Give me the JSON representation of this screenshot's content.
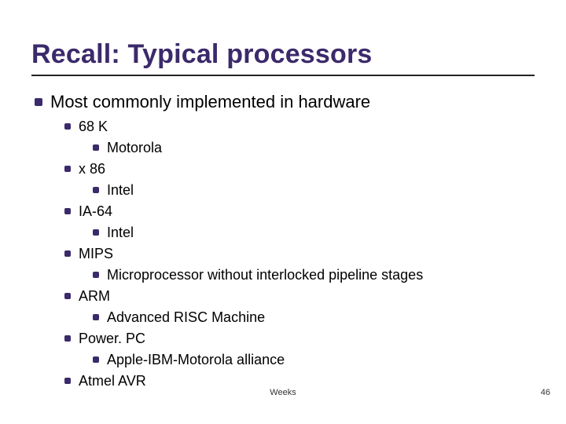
{
  "title": "Recall: Typical processors",
  "main_point": "Most commonly implemented in hardware",
  "items": [
    {
      "name": "68 K",
      "sub": "Motorola"
    },
    {
      "name": "x 86",
      "sub": "Intel"
    },
    {
      "name": "IA-64",
      "sub": "Intel"
    },
    {
      "name": "MIPS",
      "sub": "Microprocessor without interlocked pipeline stages"
    },
    {
      "name": "ARM",
      "sub": "Advanced RISC Machine"
    },
    {
      "name": "Power. PC",
      "sub": "Apple-IBM-Motorola alliance"
    },
    {
      "name": "Atmel AVR"
    }
  ],
  "footer_center": "Weeks",
  "page_number": "46"
}
